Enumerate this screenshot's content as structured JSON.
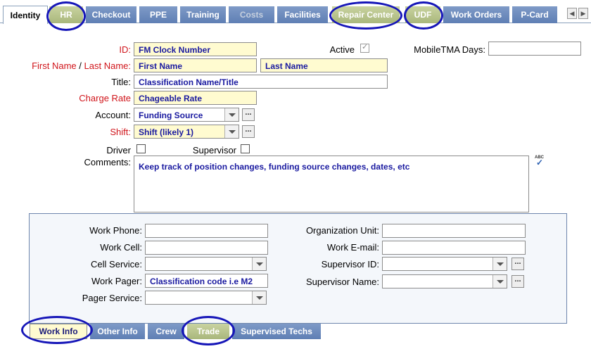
{
  "tabs": {
    "identity": "Identity",
    "hr": "HR",
    "checkout": "Checkout",
    "ppe": "PPE",
    "training": "Training",
    "costs": "Costs",
    "facilities": "Facilities",
    "repair_center": "Repair Center",
    "udf": "UDF",
    "work_orders": "Work Orders",
    "pcard": "P-Card"
  },
  "form": {
    "id_label": "ID:",
    "id_value": "FM Clock Number",
    "active_label": "Active",
    "mobile_label": "MobileTMA Days:",
    "first_name_label": "First Name",
    "slash": "/",
    "last_name_label": "Last Name:",
    "first_name_value": "First Name",
    "last_name_value": "Last Name",
    "title_label": "Title:",
    "title_value": "Classification Name/Title",
    "charge_rate_label": "Charge Rate",
    "charge_rate_value": "Chageable Rate",
    "account_label": "Account:",
    "account_value": "Funding Source",
    "shift_label": "Shift:",
    "shift_value": "Shift (likely 1)",
    "driver_label": "Driver",
    "supervisor_label": "Supervisor",
    "comments_label": "Comments:",
    "comments_value": "Keep track of position changes, funding source changes, dates, etc",
    "spell_icon_text": "ABC"
  },
  "work_info": {
    "work_phone_label": "Work Phone:",
    "work_cell_label": "Work Cell:",
    "cell_service_label": "Cell Service:",
    "work_pager_label": "Work Pager:",
    "work_pager_value": "Classification code i.e M2",
    "pager_service_label": "Pager Service:",
    "org_unit_label": "Organization Unit:",
    "work_email_label": "Work E-mail:",
    "supervisor_id_label": "Supervisor ID:",
    "supervisor_name_label": "Supervisor Name:"
  },
  "subtabs": {
    "work_info": "Work Info",
    "other_info": "Other Info",
    "crew": "Crew",
    "trade": "Trade",
    "supervised_techs": "Supervised Techs"
  },
  "colors": {
    "required_label": "#d0141a",
    "field_text": "#1a1aa0",
    "highlight_field": "#fffbd0",
    "annotation_circle": "#1616b8"
  }
}
